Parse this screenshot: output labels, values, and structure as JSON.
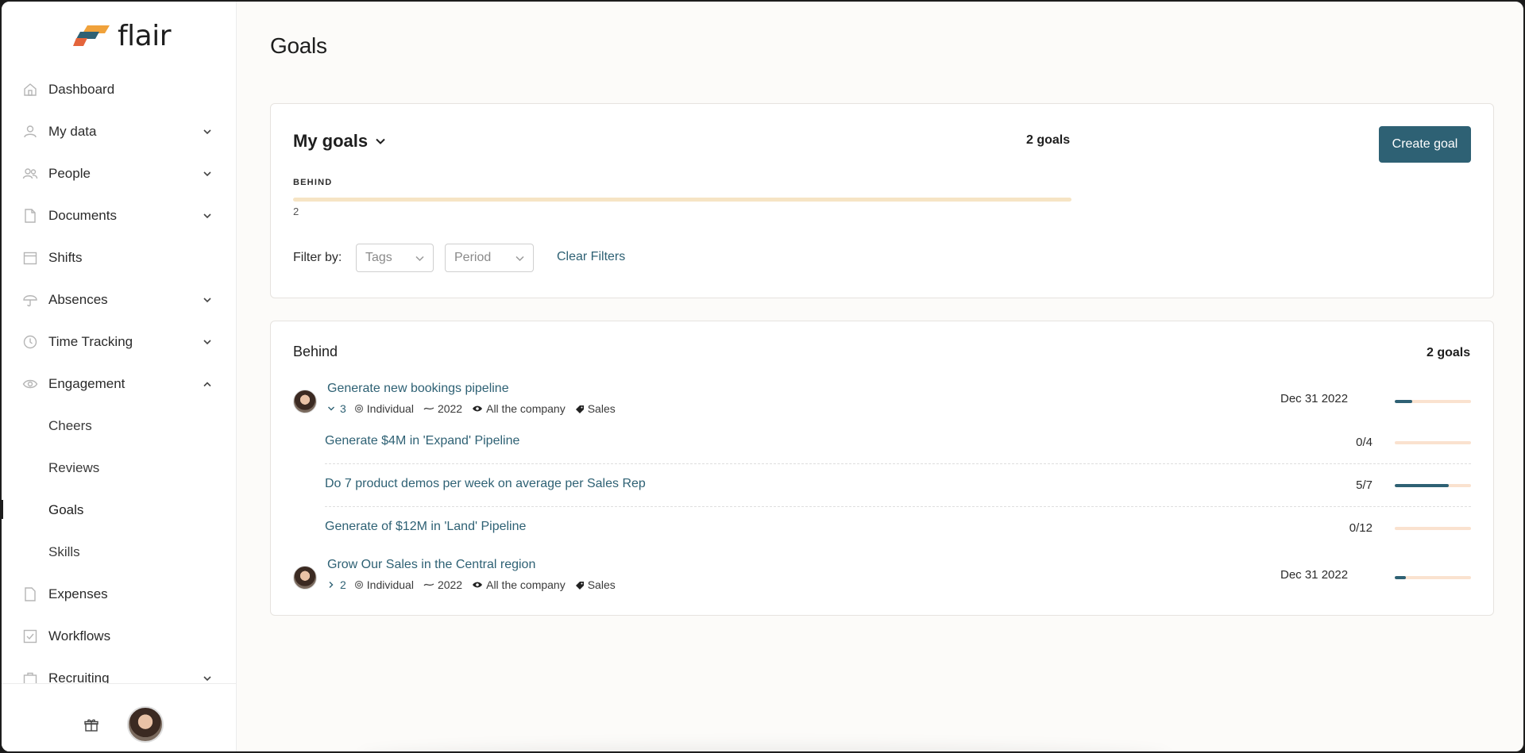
{
  "app": {
    "name": "flair",
    "brand_colors": [
      "#e4643b",
      "#f0a23b",
      "#2e6174"
    ]
  },
  "sidebar": {
    "items": [
      {
        "label": "Dashboard",
        "icon": "home-icon",
        "has_chevron": false
      },
      {
        "label": "My data",
        "icon": "person-icon",
        "has_chevron": true
      },
      {
        "label": "People",
        "icon": "people-icon",
        "has_chevron": true
      },
      {
        "label": "Documents",
        "icon": "document-icon",
        "has_chevron": true
      },
      {
        "label": "Shifts",
        "icon": "calendar-icon",
        "has_chevron": false
      },
      {
        "label": "Absences",
        "icon": "umbrella-icon",
        "has_chevron": true
      },
      {
        "label": "Time Tracking",
        "icon": "clock-icon",
        "has_chevron": true
      },
      {
        "label": "Engagement",
        "icon": "eye-icon",
        "has_chevron": true,
        "expanded": true
      },
      {
        "label": "Cheers",
        "sub": true
      },
      {
        "label": "Reviews",
        "sub": true
      },
      {
        "label": "Goals",
        "sub": true,
        "active": true
      },
      {
        "label": "Skills",
        "sub": true
      },
      {
        "label": "Expenses",
        "icon": "receipt-icon",
        "has_chevron": false
      },
      {
        "label": "Workflows",
        "icon": "checkbox-icon",
        "has_chevron": false
      },
      {
        "label": "Recruiting",
        "icon": "briefcase-icon",
        "has_chevron": true
      }
    ]
  },
  "page": {
    "title": "Goals"
  },
  "summary": {
    "title": "My goals",
    "count": "2 goals",
    "create_label": "Create goal",
    "status_label": "BEHIND",
    "status_value": "2",
    "filter_label": "Filter by:",
    "tags_placeholder": "Tags",
    "period_placeholder": "Period",
    "clear_label": "Clear Filters"
  },
  "behind": {
    "title": "Behind",
    "count": "2 goals",
    "goals": [
      {
        "title": "Generate new bookings pipeline",
        "children_count": "3",
        "type": "Individual",
        "period": "2022",
        "visibility": "All the company",
        "tag": "Sales",
        "due": "Dec 31 2022",
        "progress": 0.23,
        "expanded": true,
        "key_results": [
          {
            "title": "Generate $4M in 'Expand' Pipeline",
            "value": "0/4",
            "progress": 0.0
          },
          {
            "title": "Do 7 product demos per week on average per Sales Rep",
            "value": "5/7",
            "progress": 0.71
          },
          {
            "title": "Generate of $12M in 'Land' Pipeline",
            "value": "0/12",
            "progress": 0.0
          }
        ]
      },
      {
        "title": "Grow Our Sales in the Central region",
        "children_count": "2",
        "type": "Individual",
        "period": "2022",
        "visibility": "All the company",
        "tag": "Sales",
        "due": "Dec 31 2022",
        "progress": 0.15,
        "expanded": false
      }
    ]
  }
}
